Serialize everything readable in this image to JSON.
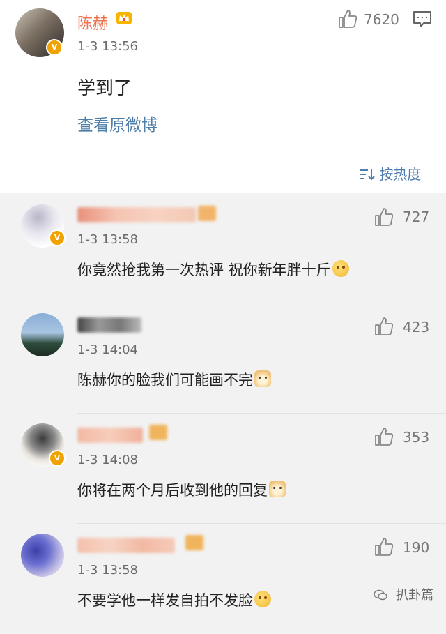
{
  "post": {
    "author": "陈赫",
    "time": "1-3 13:56",
    "likes": "7620",
    "content": "学到了",
    "view_original": "查看原微博",
    "sort_label": "按热度"
  },
  "comments": [
    {
      "time": "1-3 13:58",
      "likes": "727",
      "text": "你竟然抢我第一次热评 祝你新年胖十斤"
    },
    {
      "time": "1-3 14:04",
      "likes": "423",
      "text": "陈赫你的脸我们可能画不完"
    },
    {
      "time": "1-3 14:08",
      "likes": "353",
      "text": "你将在两个月后收到他的回复"
    },
    {
      "time": "1-3 13:58",
      "likes": "190",
      "text": "不要学他一样发自拍不发脸"
    }
  ],
  "watermark": "扒卦篇",
  "colors": {
    "name": "#eb7350",
    "link": "#4f7ea8",
    "badge": "#f0a300"
  }
}
